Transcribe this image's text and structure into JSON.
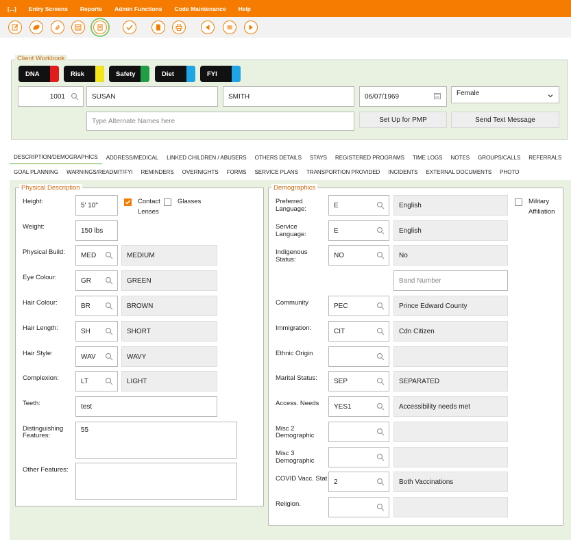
{
  "menu": [
    "[...]",
    "Entry Screens",
    "Reports",
    "Admin Functions",
    "Code Maintenance",
    "Help"
  ],
  "toolbar_icons": [
    "edit-icon",
    "pill-icon",
    "attachment-icon",
    "calendar-icon",
    "clipboard-icon",
    "check-icon",
    "document-icon",
    "print-icon",
    "previous-icon",
    "menu-icon",
    "next-icon"
  ],
  "workbook": {
    "legend": "Client Workbook",
    "alerts": [
      {
        "label": "DNA",
        "color": "#e41b1b"
      },
      {
        "label": "Risk",
        "color": "#f5e617"
      },
      {
        "label": "Safety",
        "color": "#1f9e45"
      },
      {
        "label": "Diet",
        "color": "#1ea5e6"
      },
      {
        "label": "FYI",
        "color": "#1ea5e6"
      }
    ],
    "client_id": "1001",
    "first_name": "SUSAN",
    "last_name": "SMITH",
    "dob": "06/07/1969",
    "gender": "Female",
    "alt_names_placeholder": "Type Alternate Names here",
    "pmp_button": "Set Up for PMP",
    "text_button": "Send Text Message"
  },
  "tabs_row1": [
    "DESCRIPTION/DEMOGRAPHICS",
    "ADDRESS/MEDICAL",
    "LINKED CHILDREN / ABUSERS",
    "OTHERS DETAILS",
    "STAYS",
    "REGISTERED PROGRAMS",
    "TIME LOGS",
    "NOTES",
    "GROUPS/CALLS",
    "REFERRALS"
  ],
  "tabs_row2": [
    "GOAL PLANNING",
    "WARNINGS/READMIT/FYI",
    "REMINDERS",
    "OVERNIGHTS",
    "FORMS",
    "SERVICE PLANS",
    "TRANSPORTION PROVIDED",
    "INCIDENTS",
    "EXTERNAL DOCUMENTS",
    "PHOTO"
  ],
  "physical": {
    "legend": "Physical Description",
    "height_label": "Height:",
    "height": "5' 10\"",
    "contact_lenses": "Contact Lenses",
    "contact_lenses_part1": "Contact",
    "contact_lenses_part2": "Lenses",
    "glasses": "Glasses",
    "weight_label": "Weight:",
    "weight": "150 lbs",
    "rows": [
      {
        "label": "Physical Build:",
        "code": "MED",
        "desc": "MEDIUM"
      },
      {
        "label": "Eye Colour:",
        "code": "GR",
        "desc": "GREEN"
      },
      {
        "label": "Hair Colour:",
        "code": "BR",
        "desc": "BROWN"
      },
      {
        "label": "Hair Length:",
        "code": "SH",
        "desc": "SHORT"
      },
      {
        "label": "Hair Style:",
        "code": "WAV",
        "desc": "WAVY"
      },
      {
        "label": "Complexion:",
        "code": "LT",
        "desc": "LIGHT"
      }
    ],
    "teeth_label": "Teeth:",
    "teeth": "test",
    "distinguishing_label_1": "Distinguishing",
    "distinguishing_label_2": "Features:",
    "distinguishing": "55",
    "other_label": "Other Features:",
    "other": ""
  },
  "demographics": {
    "legend": "Demographics",
    "military_1": "Military",
    "military_2": "Affiliation",
    "band_placeholder": "Band Number",
    "rows": [
      {
        "label1": "Preferred",
        "label2": "Language:",
        "code": "E",
        "desc": "English"
      },
      {
        "label1": "Service",
        "label2": "Language:",
        "code": "E",
        "desc": "English"
      },
      {
        "label1": "Indigenous",
        "label2": "Status:",
        "code": "NO",
        "desc": "No"
      },
      {
        "label1": "Community",
        "label2": "",
        "code": "PEC",
        "desc": "Prince Edward County"
      },
      {
        "label1": "Immigration:",
        "label2": "",
        "code": "CIT",
        "desc": "Cdn Citizen"
      },
      {
        "label1": "Ethnic Origin",
        "label2": "",
        "code": "",
        "desc": ""
      },
      {
        "label1": "Marital Status:",
        "label2": "",
        "code": "SEP",
        "desc": "SEPARATED"
      },
      {
        "label1": "Access. Needs",
        "label2": "",
        "code": "YES1",
        "desc": "Accessibility needs met"
      },
      {
        "label1": "Misc 2",
        "label2": "Demographic",
        "code": "",
        "desc": ""
      },
      {
        "label1": "Misc 3",
        "label2": "Demographic",
        "code": "",
        "desc": ""
      },
      {
        "label1": "COVID Vacc. Stat",
        "label2": "",
        "code": "2",
        "desc": "Both Vaccinations"
      },
      {
        "label1": "Religion.",
        "label2": "",
        "code": "",
        "desc": ""
      }
    ]
  },
  "colors": {
    "accent": "#f57c00",
    "panel": "#e9f2e1",
    "legend": "#cf6a10"
  }
}
